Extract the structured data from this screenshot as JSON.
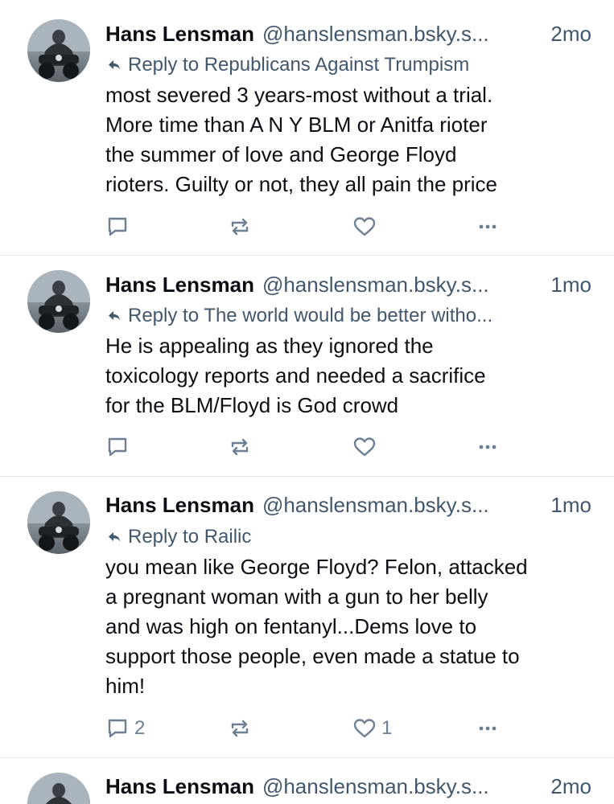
{
  "posts": [
    {
      "name": "Hans Lensman",
      "handle": "@hanslensman.bsky.s...",
      "time": "2mo",
      "reply_to": "Reply to Republicans Against Trumpism",
      "lines": [
        "most severed 3 years-most without a trial.",
        "More time than A N Y BLM or Anitfa rioter",
        "the summer of love and George Floyd",
        "rioters. Guilty or not, they all pain the price"
      ],
      "reply_count": "",
      "like_count": ""
    },
    {
      "name": "Hans Lensman",
      "handle": "@hanslensman.bsky.s...",
      "time": "1mo",
      "reply_to": "Reply to The world would be better witho...",
      "lines": [
        "He is appealing as they ignored the",
        "toxicology reports and needed a sacrifice",
        "for the BLM/Floyd is God crowd"
      ],
      "reply_count": "",
      "like_count": ""
    },
    {
      "name": "Hans Lensman",
      "handle": "@hanslensman.bsky.s...",
      "time": "1mo",
      "reply_to": "Reply to Railic",
      "lines": [
        "you mean like George Floyd? Felon, attacked",
        "a pregnant woman with a gun to her belly",
        "and was high on fentanyl...Dems love to",
        "support those people, even made a statue to",
        "him!"
      ],
      "reply_count": "2",
      "like_count": "1"
    },
    {
      "name": "Hans Lensman",
      "handle": "@hanslensman.bsky.s...",
      "time": "2mo"
    }
  ],
  "icons": {
    "reply": "speech-bubble-icon",
    "repost": "repost-arrows-icon",
    "like": "heart-icon",
    "more": "ellipsis-icon",
    "reply_to": "reply-arrow-icon"
  },
  "colors": {
    "muted": "#42576c",
    "icon": "#6c7f93",
    "divider": "#e3e8ee"
  }
}
